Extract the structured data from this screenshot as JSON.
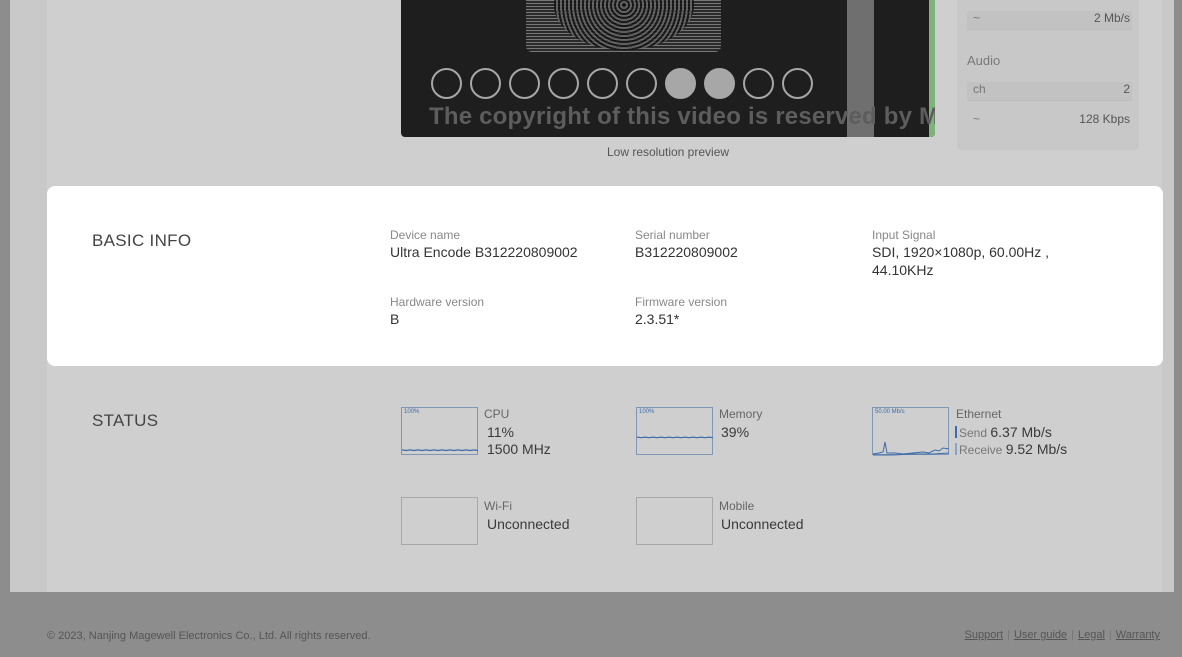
{
  "preview": {
    "copyright_text": "The copyright of this video is reserved by Magewell",
    "caption": "Low resolution preview",
    "circle_states": [
      false,
      false,
      false,
      false,
      false,
      false,
      true,
      true,
      false,
      false
    ]
  },
  "stats": {
    "video_bitrate_icon": "~",
    "video_bitrate": "2 Mb/s",
    "audio_title": "Audio",
    "audio_channels_label": "ch",
    "audio_channels": "2",
    "audio_bitrate_icon": "~",
    "audio_bitrate": "128 Kbps"
  },
  "basic_info": {
    "title": "BASIC INFO",
    "device_name_label": "Device name",
    "device_name": "Ultra Encode B312220809002",
    "serial_label": "Serial number",
    "serial": "B312220809002",
    "input_signal_label": "Input Signal",
    "input_signal_line1": "SDI, 1920×1080p, 60.00Hz ,",
    "input_signal_line2": "44.10KHz",
    "hardware_label": "Hardware version",
    "hardware": "B",
    "firmware_label": "Firmware version",
    "firmware": "2.3.51*"
  },
  "status": {
    "title": "STATUS",
    "cpu": {
      "scale": "100%",
      "label": "CPU",
      "usage": "11%",
      "freq": "1500 MHz",
      "level": 0.11
    },
    "memory": {
      "scale": "100%",
      "label": "Memory",
      "usage": "39%",
      "level": 0.39
    },
    "ethernet": {
      "scale": "50.00 Mb/s",
      "label": "Ethernet",
      "send_label": "Send",
      "send_value": "6.37 Mb/s",
      "receive_label": "Receive",
      "receive_value": "9.52 Mb/s"
    },
    "wifi": {
      "label": "Wi-Fi",
      "state": "Unconnected"
    },
    "mobile": {
      "label": "Mobile",
      "state": "Unconnected"
    }
  },
  "footer": {
    "copyright": "© 2023, Nanjing Magewell Electronics Co., Ltd. All rights reserved.",
    "links": [
      "Support",
      "User guide",
      "Legal",
      "Warranty"
    ]
  },
  "colors": {
    "overlay": "#8d8d8d",
    "card": "#ffffff",
    "graph_line": "#3d6ca8"
  }
}
